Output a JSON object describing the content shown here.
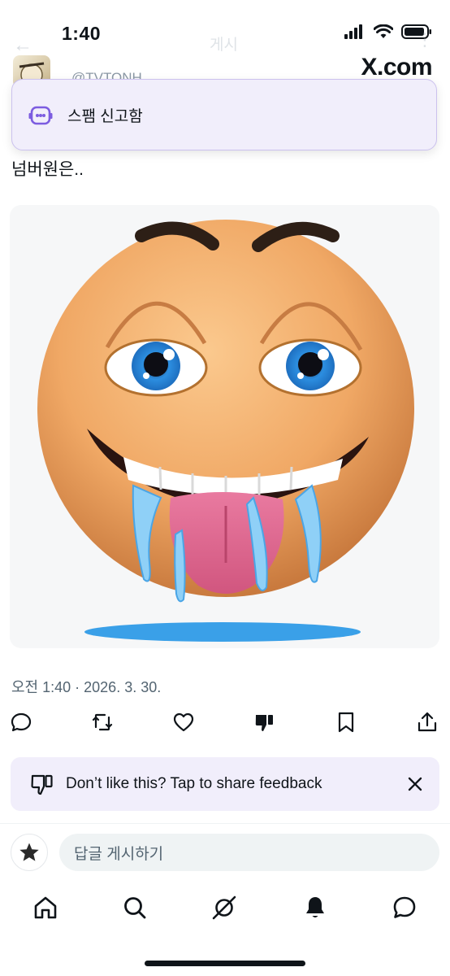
{
  "status_bar": {
    "time": "1:40"
  },
  "header": {
    "title": "게시"
  },
  "tweet": {
    "handle": "@TVTONH",
    "text": "넘버원은..",
    "timestamp": "오전 1:40 · 2026. 3. 30.",
    "image_watermark": "X.com"
  },
  "toast": {
    "text": "스팸 신고함"
  },
  "actions": [
    "reply-icon",
    "retweet-icon",
    "like-icon",
    "dislike-icon",
    "bookmark-icon",
    "share-icon"
  ],
  "feedback": {
    "text": "Don’t like this? Tap to share feedback"
  },
  "reply": {
    "placeholder": "답글 게시하기"
  },
  "bottom_nav": [
    "home-icon",
    "search-icon",
    "grok-icon",
    "notifications-icon",
    "messages-icon"
  ],
  "colors": {
    "toast_bg": "#f1eefb",
    "toast_border": "#cbc1ee",
    "accent_purple": "#7c5ce0",
    "text_primary": "#0f1419",
    "text_secondary": "#536471"
  }
}
